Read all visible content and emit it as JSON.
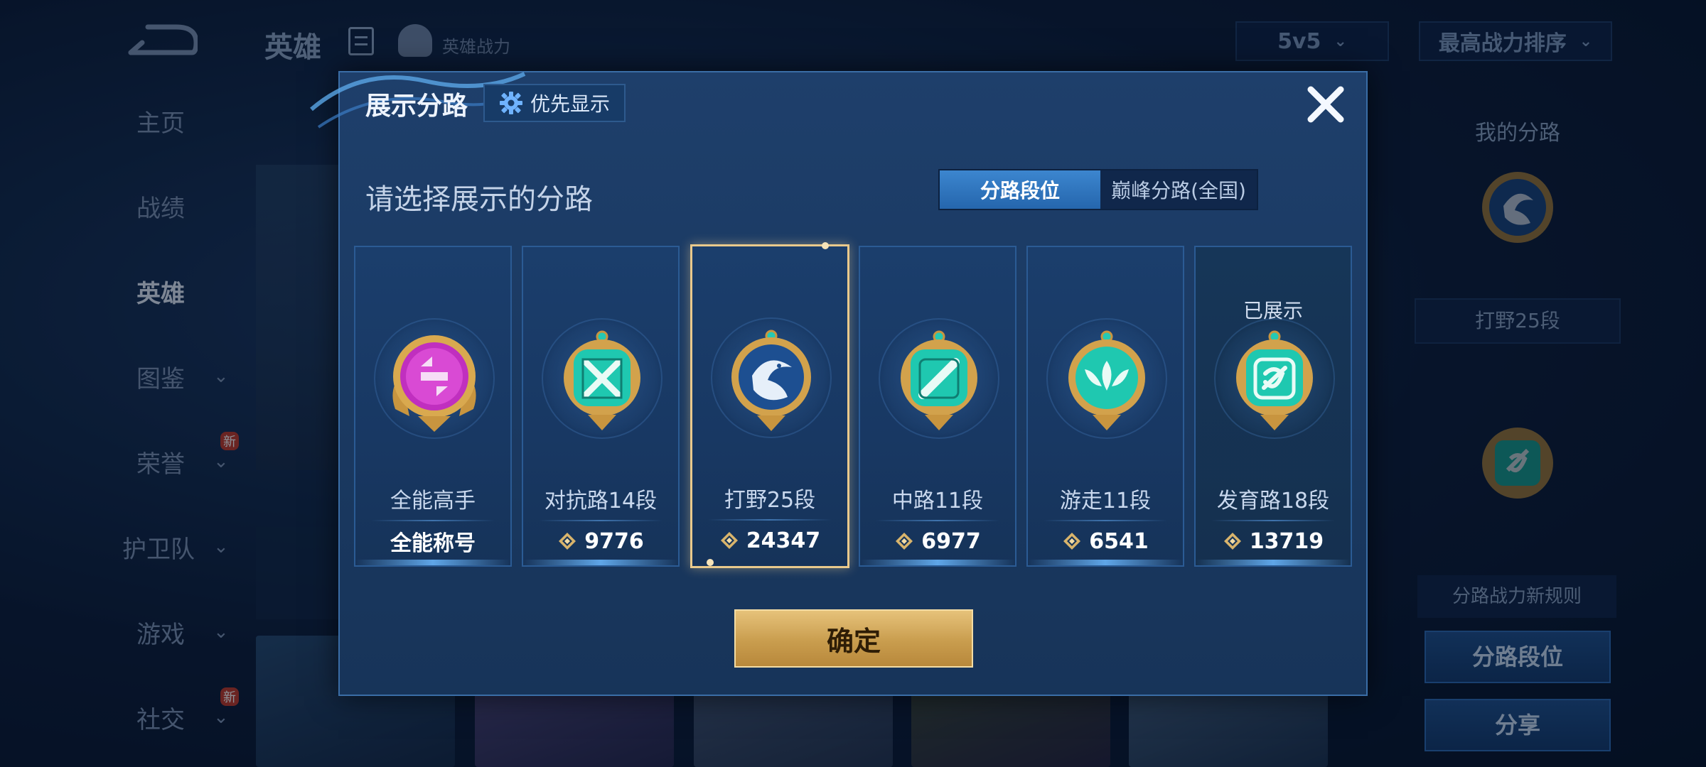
{
  "header": {
    "title": "英雄",
    "power_label": "英雄战力",
    "mode_select": "5v5",
    "sort_select": "最高战力排序"
  },
  "side_nav": [
    {
      "label": "主页"
    },
    {
      "label": "战绩"
    },
    {
      "label": "英雄"
    },
    {
      "label": "图鉴"
    },
    {
      "label": "荣誉",
      "badge": "新"
    },
    {
      "label": "护卫队"
    },
    {
      "label": "游戏"
    },
    {
      "label": "社交",
      "badge": "新"
    }
  ],
  "right_panel": {
    "title": "我的分路",
    "rank": "打野25段",
    "rule": "分路战力新规则",
    "btn_rank": "分路段位",
    "btn_share": "分享"
  },
  "modal": {
    "title": "展示分路",
    "priority_label": "优先显示",
    "subtitle": "请选择展示的分路",
    "tabs": [
      "分路段位",
      "巅峰分路(全国)"
    ],
    "confirm": "确定",
    "cards": [
      {
        "name": "全能高手",
        "value": "全能称号",
        "emblem": "allround-emblem-icon"
      },
      {
        "name": "对抗路14段",
        "value": "9776",
        "emblem": "clash-lane-emblem-icon"
      },
      {
        "name": "打野25段",
        "value": "24347",
        "emblem": "jungle-emblem-icon",
        "selected": true
      },
      {
        "name": "中路11段",
        "value": "6977",
        "emblem": "mid-lane-emblem-icon"
      },
      {
        "name": "游走11段",
        "value": "6541",
        "emblem": "roam-emblem-icon"
      },
      {
        "name": "发育路18段",
        "value": "13719",
        "emblem": "farm-lane-emblem-icon",
        "shown_label": "已展示"
      }
    ]
  },
  "colors": {
    "accent_blue": "#2566ad",
    "gold": "#e6c27a",
    "selected_border": "#e9c98c",
    "emblem_teal": "#1fc8b0",
    "emblem_magenta": "#c02fbf"
  }
}
